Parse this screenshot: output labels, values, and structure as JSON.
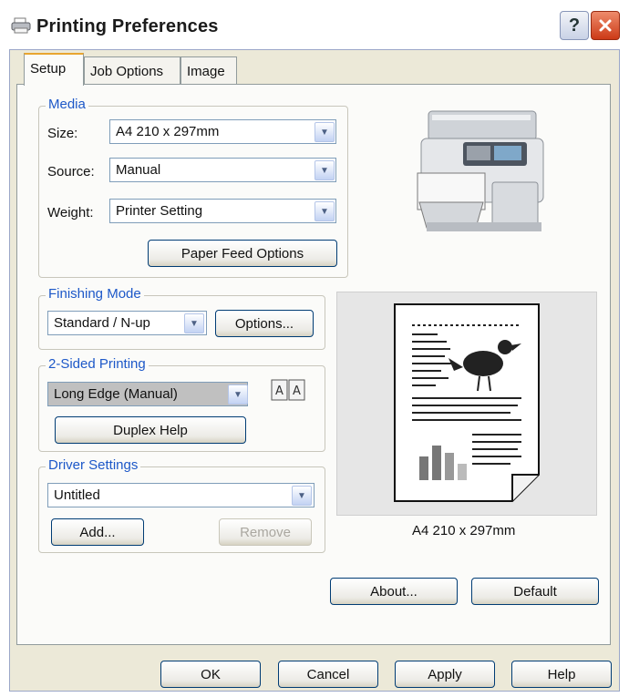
{
  "window": {
    "title": "Printing Preferences"
  },
  "tabs": [
    "Setup",
    "Job Options",
    "Image"
  ],
  "media": {
    "legend": "Media",
    "size_label": "Size:",
    "size_value": "A4 210 x 297mm",
    "source_label": "Source:",
    "source_value": "Manual",
    "weight_label": "Weight:",
    "weight_value": "Printer Setting",
    "paper_feed_button": "Paper Feed Options"
  },
  "finishing": {
    "legend": "Finishing Mode",
    "value": "Standard / N-up",
    "options_button": "Options..."
  },
  "two_sided": {
    "legend": "2-Sided Printing",
    "value": "Long Edge (Manual)",
    "duplex_help_button": "Duplex Help"
  },
  "driver": {
    "legend": "Driver Settings",
    "value": "Untitled",
    "add_button": "Add...",
    "remove_button": "Remove"
  },
  "preview": {
    "paper_size_label": "A4 210 x 297mm"
  },
  "buttons": {
    "about": "About...",
    "default": "Default",
    "ok": "OK",
    "cancel": "Cancel",
    "apply": "Apply",
    "help": "Help"
  },
  "colors": {
    "accent_blue": "#1d58c8",
    "dialog_bg": "#ece9d8",
    "panel_bg": "#fbfbf9",
    "button_border": "#003c74"
  }
}
